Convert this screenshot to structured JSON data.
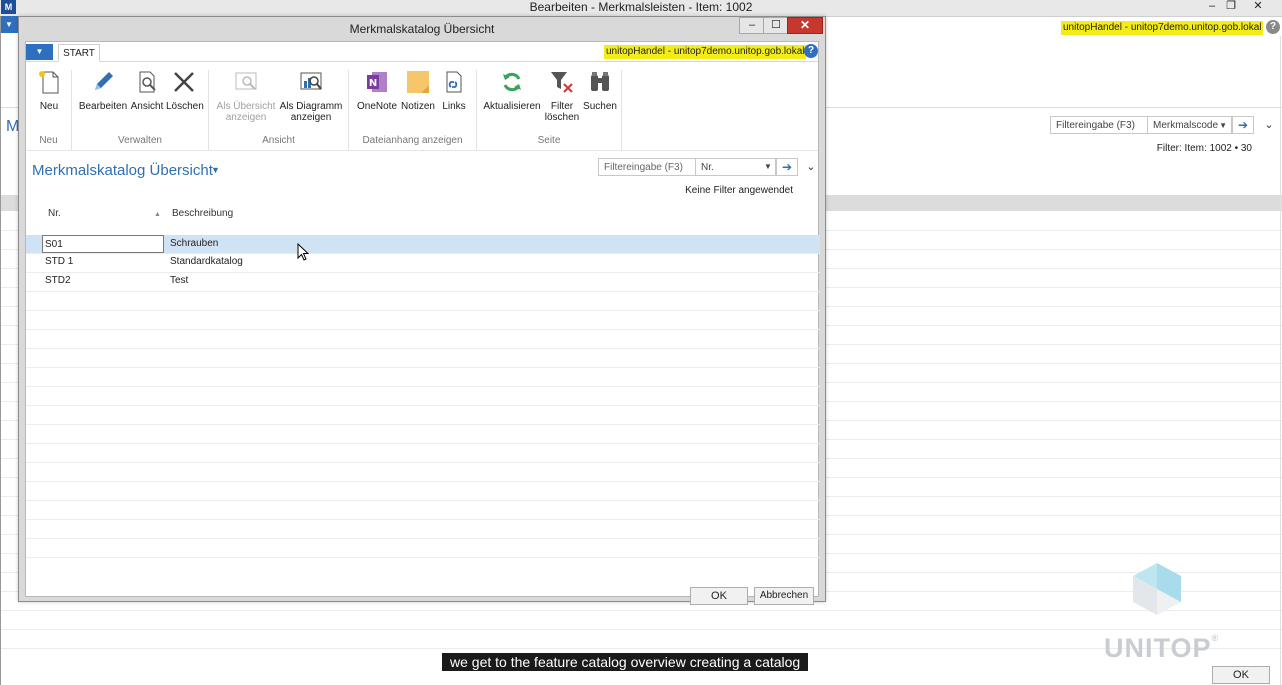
{
  "background_window": {
    "title": "Bearbeiten - Merkmalsleisten - Item: 1002",
    "app_icon_label": "M",
    "min_label": "–",
    "restore_label": "❐",
    "close_label": "✕",
    "server_badge": "unitopHandel - unitop7demo.unitop.gob.lokal",
    "help_label": "?",
    "left_letter": "M",
    "filter_placeholder": "Filtereingabe (F3)",
    "filter_field": "Merkmalscode",
    "filter_info": "Filter: Item: 1002 • 30",
    "ok_label": "OK"
  },
  "dialog": {
    "title": "Merkmalskatalog Übersicht",
    "min_label": "–",
    "max_label": "☐",
    "close_label": "✕",
    "ribbon_tab": "START",
    "server_badge": "unitopHandel - unitop7demo.unitop.gob.lokal",
    "help_label": "?",
    "ribbon_groups": {
      "neu": "Neu",
      "verwalten": "Verwalten",
      "ansicht": "Ansicht",
      "dateianhang": "Dateianhang anzeigen",
      "seite": "Seite"
    },
    "ribbon_buttons": {
      "neu": "Neu",
      "bearbeiten": "Bearbeiten",
      "ansicht": "Ansicht",
      "loeschen": "Löschen",
      "als_uebersicht_1": "Als Übersicht",
      "als_uebersicht_2": "anzeigen",
      "als_diagramm_1": "Als Diagramm",
      "als_diagramm_2": "anzeigen",
      "onenote": "OneNote",
      "notizen": "Notizen",
      "links": "Links",
      "aktualisieren": "Aktualisieren",
      "filter_loeschen_1": "Filter",
      "filter_loeschen_2": "löschen",
      "suchen": "Suchen"
    },
    "page_title": "Merkmalskatalog Übersicht",
    "filter_placeholder": "Filtereingabe (F3)",
    "filter_field": "Nr.",
    "no_filter_text": "Keine Filter angewendet",
    "columns": {
      "nr": "Nr.",
      "beschreibung": "Beschreibung"
    },
    "rows": [
      {
        "nr": "S01",
        "beschreibung": "Schrauben"
      },
      {
        "nr": "STD 1",
        "beschreibung": "Standardkatalog"
      },
      {
        "nr": "STD2",
        "beschreibung": "Test"
      }
    ],
    "ok_label": "OK",
    "cancel_label": "Abbrechen"
  },
  "brand": {
    "logo_text": "UNITOP",
    "registered": "®"
  },
  "subtitle": "we get to the feature catalog overview creating a catalog",
  "colors": {
    "accent": "#2f6fb2",
    "badge": "#f3ec18",
    "selected_row": "#cfe3f5",
    "close_red": "#c6372e"
  }
}
